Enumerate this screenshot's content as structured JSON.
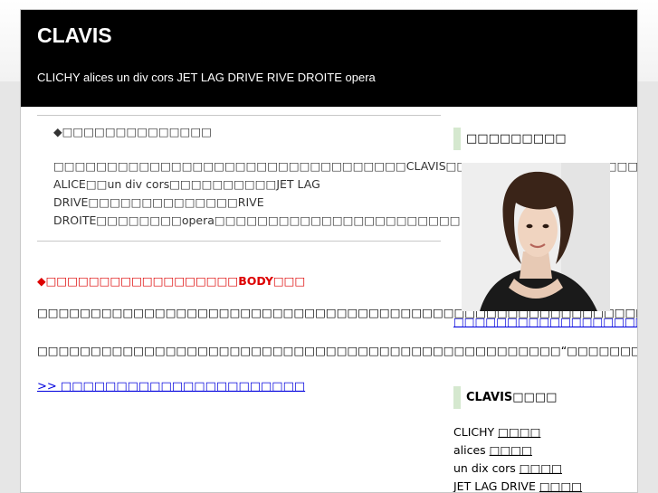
{
  "header": {
    "title": "CLAVIS",
    "description": "CLICHY alices un div cors JET LAG DRIVE RIVE DROITE opera"
  },
  "intro": {
    "heading": "◆□□□□□□□□□□□□□□",
    "text": "□□□□□□□□□□□□□□□□□□□□□□□□□□□□□□□□□CLAVIS□□□□□□□□□□□□□□□□□□□□□□□□□CLICHY□□□□□□□□alices□□□□□□※□Miss ALICE□□un div cors□□□□□□□□□□JET LAG DRIVE□□□□□□□□□□□□□□RIVE DROITE□□□□□□□□opera□□□□□□□□□□□□□□□□□□□□□□□"
  },
  "notice": "◆□□□□□□□□□□□□□□□□□□BODY□□□",
  "body_para1": {
    "before": "□□□□□□□□□□□□□□□□□□□□□□□□□□□□□□□□□□□□□□□□□□□□□□□□□□□□□□□□□□□□CLICHY□□□□□□□□□□□□□□□□",
    "highlight": "□□□□□□□□□□□□□□□",
    "after": "□□□□□□□□□□□□□□□□□□□□□□□□□□□□□□□□□□□"
  },
  "body_para2": "□□□□□□□□□□□□□□□□□□□□□□□□□□□□□□□□□□□□□□□□□□□□□□□□□“□□□□□□□□□”□□□□□□□□□□□□□□□□□□□□□□□□□□□□□□□□□□□□□",
  "more_link": ">> □□□□□□□□□□□□□□□□□□□□□□",
  "sidebar": {
    "heading1": "□□□□□□□□□",
    "photo_link": "□□□□□□□□□□□□□□□□□□□□□□",
    "heading2": "CLAVIS□□□□",
    "brands": [
      {
        "name": "CLICHY",
        "link": "□□□□"
      },
      {
        "name": "alices",
        "link": "□□□□"
      },
      {
        "name": "un dix cors",
        "link": "□□□□"
      },
      {
        "name": "JET LAG DRIVE",
        "link": "□□□□"
      }
    ]
  }
}
